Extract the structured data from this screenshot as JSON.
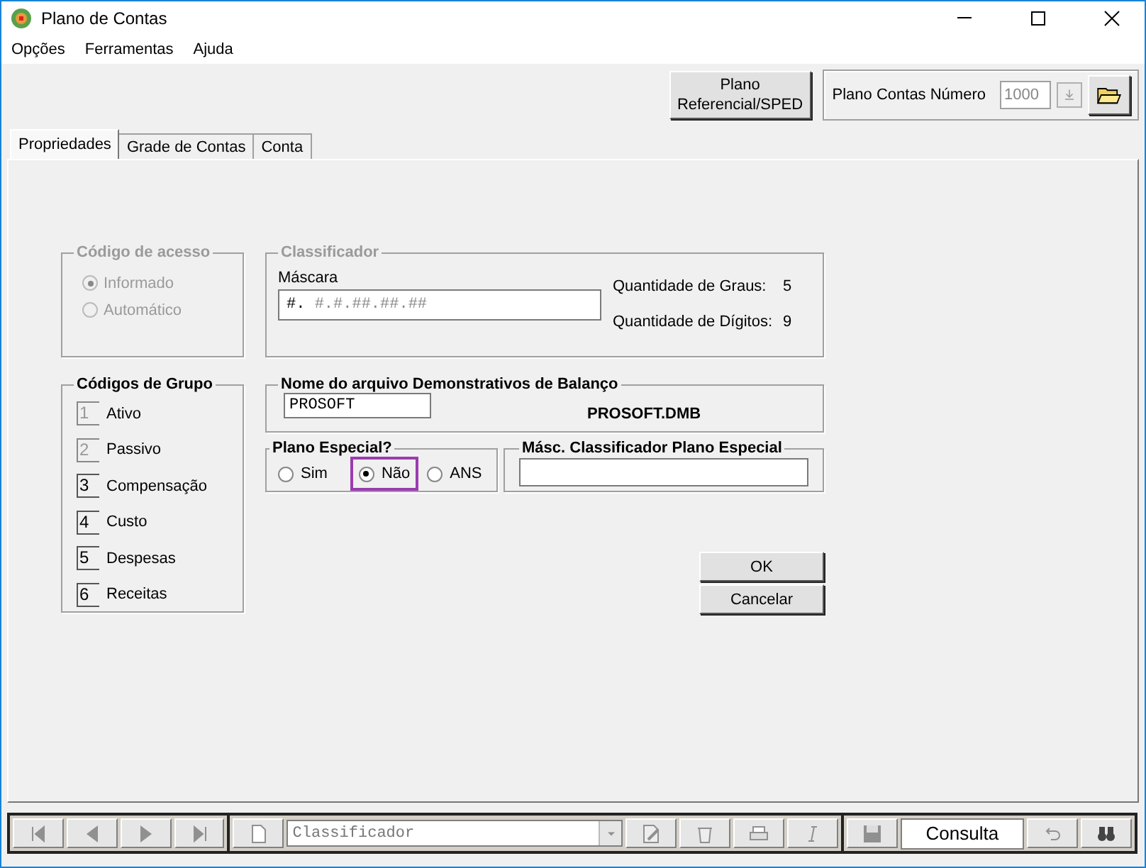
{
  "window": {
    "title": "Plano de Contas"
  },
  "menu": [
    "Opções",
    "Ferramentas",
    "Ajuda"
  ],
  "toolbar": {
    "referencial_button": "Plano Referencial/SPED",
    "numero_label": "Plano Contas Número",
    "numero_value": "1000"
  },
  "tabs": [
    {
      "label": "Propriedades",
      "selected": true
    },
    {
      "label": "Grade de Contas",
      "selected": false
    },
    {
      "label": "Conta",
      "selected": false
    }
  ],
  "codigo_acesso": {
    "title": "Código de acesso",
    "disabled": true,
    "options": [
      {
        "label": "Informado",
        "selected": true
      },
      {
        "label": "Automático",
        "selected": false
      }
    ]
  },
  "classificador": {
    "title": "Classificador",
    "mask_label": "Máscara",
    "mask_typed": "#.",
    "mask_rest": "#.#.##.##.##",
    "graus_label": "Quantidade de Graus:",
    "graus": "5",
    "digitos_label": "Quantidade de Dígitos:",
    "digitos": "9"
  },
  "codigos_grupo": {
    "title": "Códigos de Grupo",
    "items": [
      {
        "code": "1",
        "label": "Ativo",
        "disabled": true
      },
      {
        "code": "2",
        "label": "Passivo",
        "disabled": true
      },
      {
        "code": "3",
        "label": "Compensação",
        "disabled": false
      },
      {
        "code": "4",
        "label": "Custo",
        "disabled": false
      },
      {
        "code": "5",
        "label": "Despesas",
        "disabled": false
      },
      {
        "code": "6",
        "label": "Receitas",
        "disabled": false
      }
    ]
  },
  "arquivo": {
    "title": "Nome do arquivo Demonstrativos de Balanço",
    "value": "PROSOFT",
    "filename": "PROSOFT.DMB"
  },
  "plano_especial": {
    "title": "Plano Especial?",
    "options": [
      {
        "label": "Sim",
        "selected": false,
        "highlighted": false
      },
      {
        "label": "Não",
        "selected": true,
        "highlighted": true
      },
      {
        "label": "ANS",
        "selected": false,
        "highlighted": false
      }
    ]
  },
  "masc_especial": {
    "title": "Másc. Classificador Plano Especial"
  },
  "buttons": [
    "OK",
    "Cancelar"
  ],
  "navbar": {
    "field": "Classificador",
    "mode": "Consulta"
  }
}
